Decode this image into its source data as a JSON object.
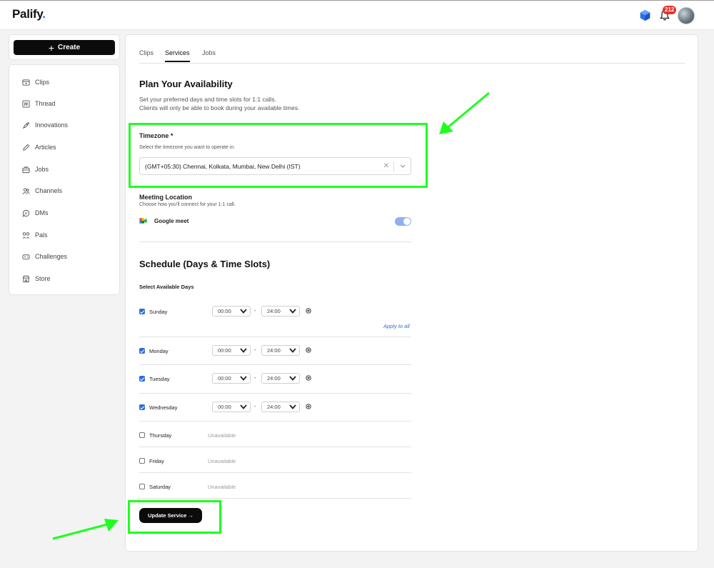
{
  "app": {
    "logo": "Palify",
    "logo_dot": "."
  },
  "header": {
    "notification_count": "212",
    "icons": [
      "cube-icon",
      "bell-icon",
      "avatar"
    ]
  },
  "sidebar": {
    "create_label": "Create",
    "items": [
      {
        "label": "Clips",
        "icon": "clips-icon"
      },
      {
        "label": "Thread",
        "icon": "hash-icon"
      },
      {
        "label": "Innovations",
        "icon": "rocket-icon"
      },
      {
        "label": "Articles",
        "icon": "pen-icon"
      },
      {
        "label": "Jobs",
        "icon": "briefcase-icon"
      },
      {
        "label": "Channels",
        "icon": "users-icon"
      },
      {
        "label": "DMs",
        "icon": "chat-icon"
      },
      {
        "label": "Pals",
        "icon": "pals-icon"
      },
      {
        "label": "Challenges",
        "icon": "gamepad-icon"
      },
      {
        "label": "Store",
        "icon": "store-icon"
      }
    ]
  },
  "tabs": [
    {
      "label": "Clips",
      "active": false
    },
    {
      "label": "Services",
      "active": true
    },
    {
      "label": "Jobs",
      "active": false
    }
  ],
  "availability": {
    "title": "Plan Your Availability",
    "desc1": "Set your preferred days and time slots for 1:1 calls.",
    "desc2": "Clients will only be able to book during your available times.",
    "timezone_label": "Timezone *",
    "timezone_help": "Select the timezone you want to operate in.",
    "timezone_value": "(GMT+05:30) Chennai, Kolkata, Mumbai, New Delhi (IST)",
    "meeting_label": "Meeting Location",
    "meeting_help": "Choose how you'll connect for your 1:1 call.",
    "meeting_option": "Google meet",
    "meeting_enabled": true
  },
  "schedule": {
    "title": "Schedule (Days & Time Slots)",
    "select_label": "Select Available Days",
    "apply_all": "Apply to all",
    "unavailable_text": "Unavailable",
    "days": [
      {
        "name": "Sunday",
        "checked": true,
        "start": "00:00",
        "end": "24:00"
      },
      {
        "name": "Monday",
        "checked": true,
        "start": "00:00",
        "end": "24:00"
      },
      {
        "name": "Tuesday",
        "checked": true,
        "start": "00:00",
        "end": "24:00"
      },
      {
        "name": "Wednesday",
        "checked": true,
        "start": "00:00",
        "end": "24:00"
      },
      {
        "name": "Thursday",
        "checked": false
      },
      {
        "name": "Friday",
        "checked": false
      },
      {
        "name": "Saturday",
        "checked": false
      }
    ],
    "update_label": "Update Service →"
  },
  "annotation_color": "#1dff1d"
}
